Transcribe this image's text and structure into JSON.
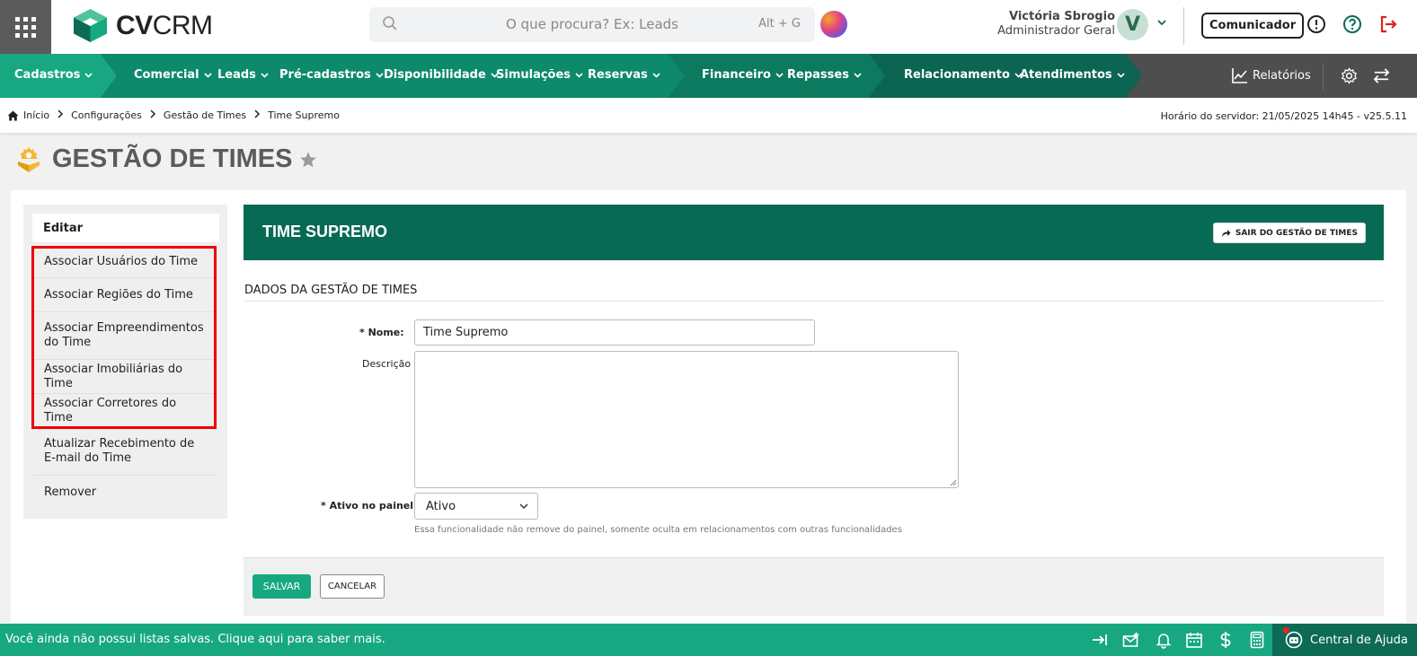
{
  "header": {
    "logo_bold": "CV",
    "logo_thin": "CRM",
    "search_placeholder": "O que procura? Ex: Leads",
    "search_shortcut": "Alt + G",
    "user_name": "Victória Sbrogio",
    "user_role": "Administrador Geral",
    "avatar_initial": "V",
    "comunicador_label": "Comunicador"
  },
  "nav": {
    "items": [
      {
        "label": "Cadastros"
      },
      {
        "label": "Comercial"
      },
      {
        "label": "Leads"
      },
      {
        "label": "Pré-cadastros"
      },
      {
        "label": "Disponibilidade"
      },
      {
        "label": "Simulações"
      },
      {
        "label": "Reservas"
      },
      {
        "label": "Financeiro"
      },
      {
        "label": "Repasses"
      },
      {
        "label": "Relacionamento"
      },
      {
        "label": "Atendimentos"
      }
    ],
    "reports_label": "Relatórios"
  },
  "breadcrumb": {
    "items": [
      "Início",
      "Configurações",
      "Gestão de Times",
      "Time Supremo"
    ],
    "server_time": "Horário do servidor: 21/05/2025 14h45 - v25.5.11"
  },
  "page": {
    "title": "GESTÃO DE TIMES"
  },
  "sidebar": {
    "heading": "Editar",
    "items": [
      "Associar Usuários do Time",
      "Associar Regiões do Time",
      "Associar Empreendimentos do Time",
      "Associar Imobiliárias do Time",
      "Associar Corretores do Time",
      "Atualizar Recebimento de E-mail do Time",
      "Remover"
    ]
  },
  "team": {
    "title": "TIME SUPREMO",
    "exit_label": "SAIR DO GESTÃO DE TIMES",
    "section_title": "DADOS DA GESTÃO DE TIMES"
  },
  "form": {
    "name_label": "* Nome:",
    "name_value": "Time Supremo",
    "description_label": "Descrição",
    "description_value": "",
    "active_label": "* Ativo no painel",
    "active_value": "Ativo",
    "helper": "Essa funcionalidade não remove do painel, somente oculta em relacionamentos com outras funcionalidades",
    "save_label": "SALVAR",
    "cancel_label": "CANCELAR"
  },
  "bottom": {
    "lists_message": "Você ainda não possui listas salvas. Clique aqui para saber mais.",
    "help_label": "Central de Ajuda"
  },
  "colors": {
    "nav_green": "#17a882",
    "nav_dark_green": "#0d6a55",
    "banner_green": "#076a54",
    "highlight_red": "#ee0000"
  }
}
